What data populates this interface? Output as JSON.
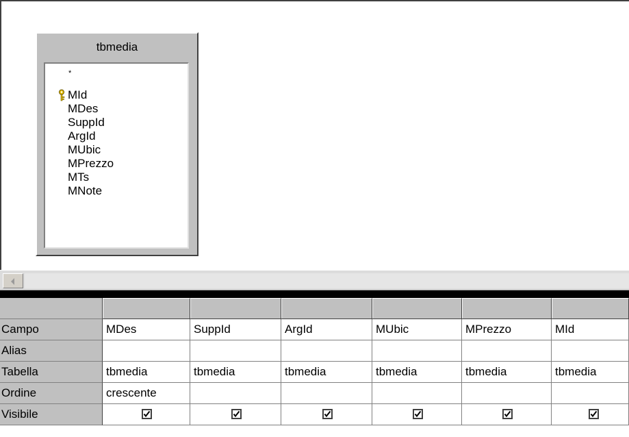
{
  "table": {
    "name": "tbmedia",
    "all_fields": "*",
    "fields": [
      "MId",
      "MDes",
      "SuppId",
      "ArgId",
      "MUbic",
      "MPrezzo",
      "MTs",
      "MNote"
    ],
    "primary_key": "MId"
  },
  "grid": {
    "row_labels": {
      "field": "Campo",
      "alias": "Alias",
      "table": "Tabella",
      "sort": "Ordine",
      "visible": "Visibile"
    },
    "columns": [
      {
        "field": "MDes",
        "alias": "",
        "table": "tbmedia",
        "sort": "crescente",
        "visible": true
      },
      {
        "field": "SuppId",
        "alias": "",
        "table": "tbmedia",
        "sort": "",
        "visible": true
      },
      {
        "field": "ArgId",
        "alias": "",
        "table": "tbmedia",
        "sort": "",
        "visible": true
      },
      {
        "field": "MUbic",
        "alias": "",
        "table": "tbmedia",
        "sort": "",
        "visible": true
      },
      {
        "field": "MPrezzo",
        "alias": "",
        "table": "tbmedia",
        "sort": "",
        "visible": true
      },
      {
        "field": "MId",
        "alias": "",
        "table": "tbmedia",
        "sort": "",
        "visible": true
      }
    ]
  },
  "icons": {
    "key": "key-icon",
    "checkbox": "checkbox-checked-icon",
    "scroll_left": "arrow-left-icon"
  },
  "colors": {
    "key_icon": "#e8c000",
    "panel_gray": "#c0c0c0",
    "divider": "#000000"
  }
}
